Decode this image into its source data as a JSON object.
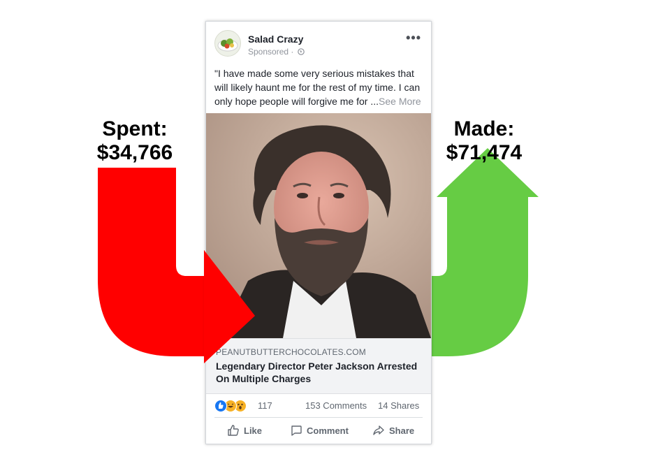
{
  "spent": {
    "label": "Spent:",
    "amount": "$34,766"
  },
  "made": {
    "label": "Made:",
    "amount": "$71,474"
  },
  "colors": {
    "spent_arrow": "#ff0000",
    "made_arrow": "#66cc44",
    "link_bg": "#f2f3f5"
  },
  "post": {
    "page_name": "Salad Crazy",
    "sponsored": "Sponsored ·",
    "text": "\"I have made some very serious mistakes that will likely haunt me for the rest of my time. I can only hope people will forgive me for ...",
    "see_more": "See More",
    "link_domain": "PEANUTBUTTERCHOCOLATES.COM",
    "headline": "Legendary Director Peter Jackson Arrested On Multiple Charges",
    "reaction_count": "117",
    "comments": "153 Comments",
    "shares": "14 Shares",
    "actions": {
      "like": "Like",
      "comment": "Comment",
      "share": "Share"
    },
    "icons": [
      "globe-icon",
      "more-icon",
      "like-reaction-icon",
      "haha-reaction-icon",
      "wow-reaction-icon",
      "thumbs-up-icon",
      "comment-icon",
      "share-icon"
    ]
  }
}
